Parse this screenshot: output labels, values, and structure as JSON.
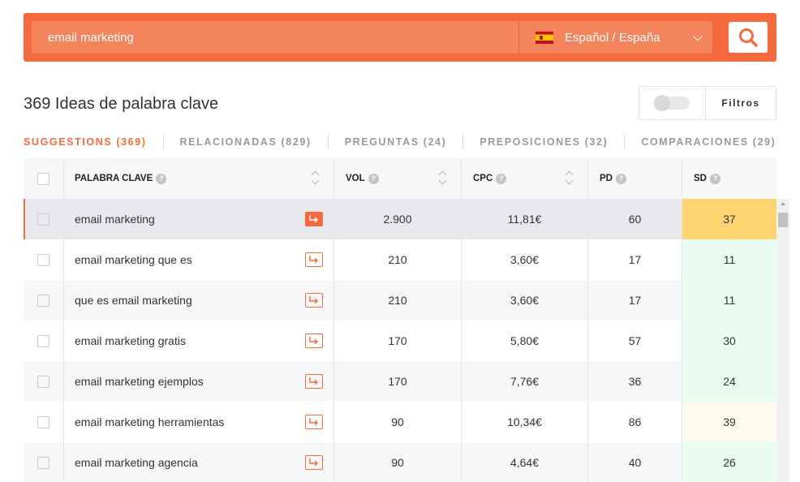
{
  "search": {
    "value": "email marketing",
    "language": "Español / España",
    "flag_icon": "spain-flag-icon",
    "button_icon": "search-icon"
  },
  "title": "369 Ideas de palabra clave",
  "filters": {
    "label": "Filtros"
  },
  "tabs": [
    {
      "label": "SUGGESTIONS (369)",
      "active": true
    },
    {
      "label": "RELACIONADAS (829)",
      "active": false
    },
    {
      "label": "PREGUNTAS (24)",
      "active": false
    },
    {
      "label": "PREPOSICIONES (32)",
      "active": false
    },
    {
      "label": "COMPARACIONES (29)",
      "active": false
    }
  ],
  "table": {
    "headers": {
      "keyword": "PALABRA CLAVE",
      "vol": "VOL",
      "cpc": "CPC",
      "pd": "PD",
      "sd": "SD"
    },
    "rows": [
      {
        "keyword": "email marketing",
        "vol": "2.900",
        "cpc": "11,81€",
        "pd": "60",
        "sd": "37"
      },
      {
        "keyword": "email marketing que es",
        "vol": "210",
        "cpc": "3,60€",
        "pd": "17",
        "sd": "11"
      },
      {
        "keyword": "que es email marketing",
        "vol": "210",
        "cpc": "3,60€",
        "pd": "17",
        "sd": "11"
      },
      {
        "keyword": "email marketing gratis",
        "vol": "170",
        "cpc": "5,80€",
        "pd": "57",
        "sd": "30"
      },
      {
        "keyword": "email marketing ejemplos",
        "vol": "170",
        "cpc": "7,76€",
        "pd": "36",
        "sd": "24"
      },
      {
        "keyword": "email marketing herramientas",
        "vol": "90",
        "cpc": "10,34€",
        "pd": "86",
        "sd": "39"
      },
      {
        "keyword": "email marketing agencia",
        "vol": "90",
        "cpc": "4,64€",
        "pd": "40",
        "sd": "26"
      }
    ]
  },
  "colors": {
    "accent": "#f46a3d",
    "sd_high": "#ffd470",
    "sd_low": "#e8fdf0",
    "sd_mid": "#fefaec"
  }
}
